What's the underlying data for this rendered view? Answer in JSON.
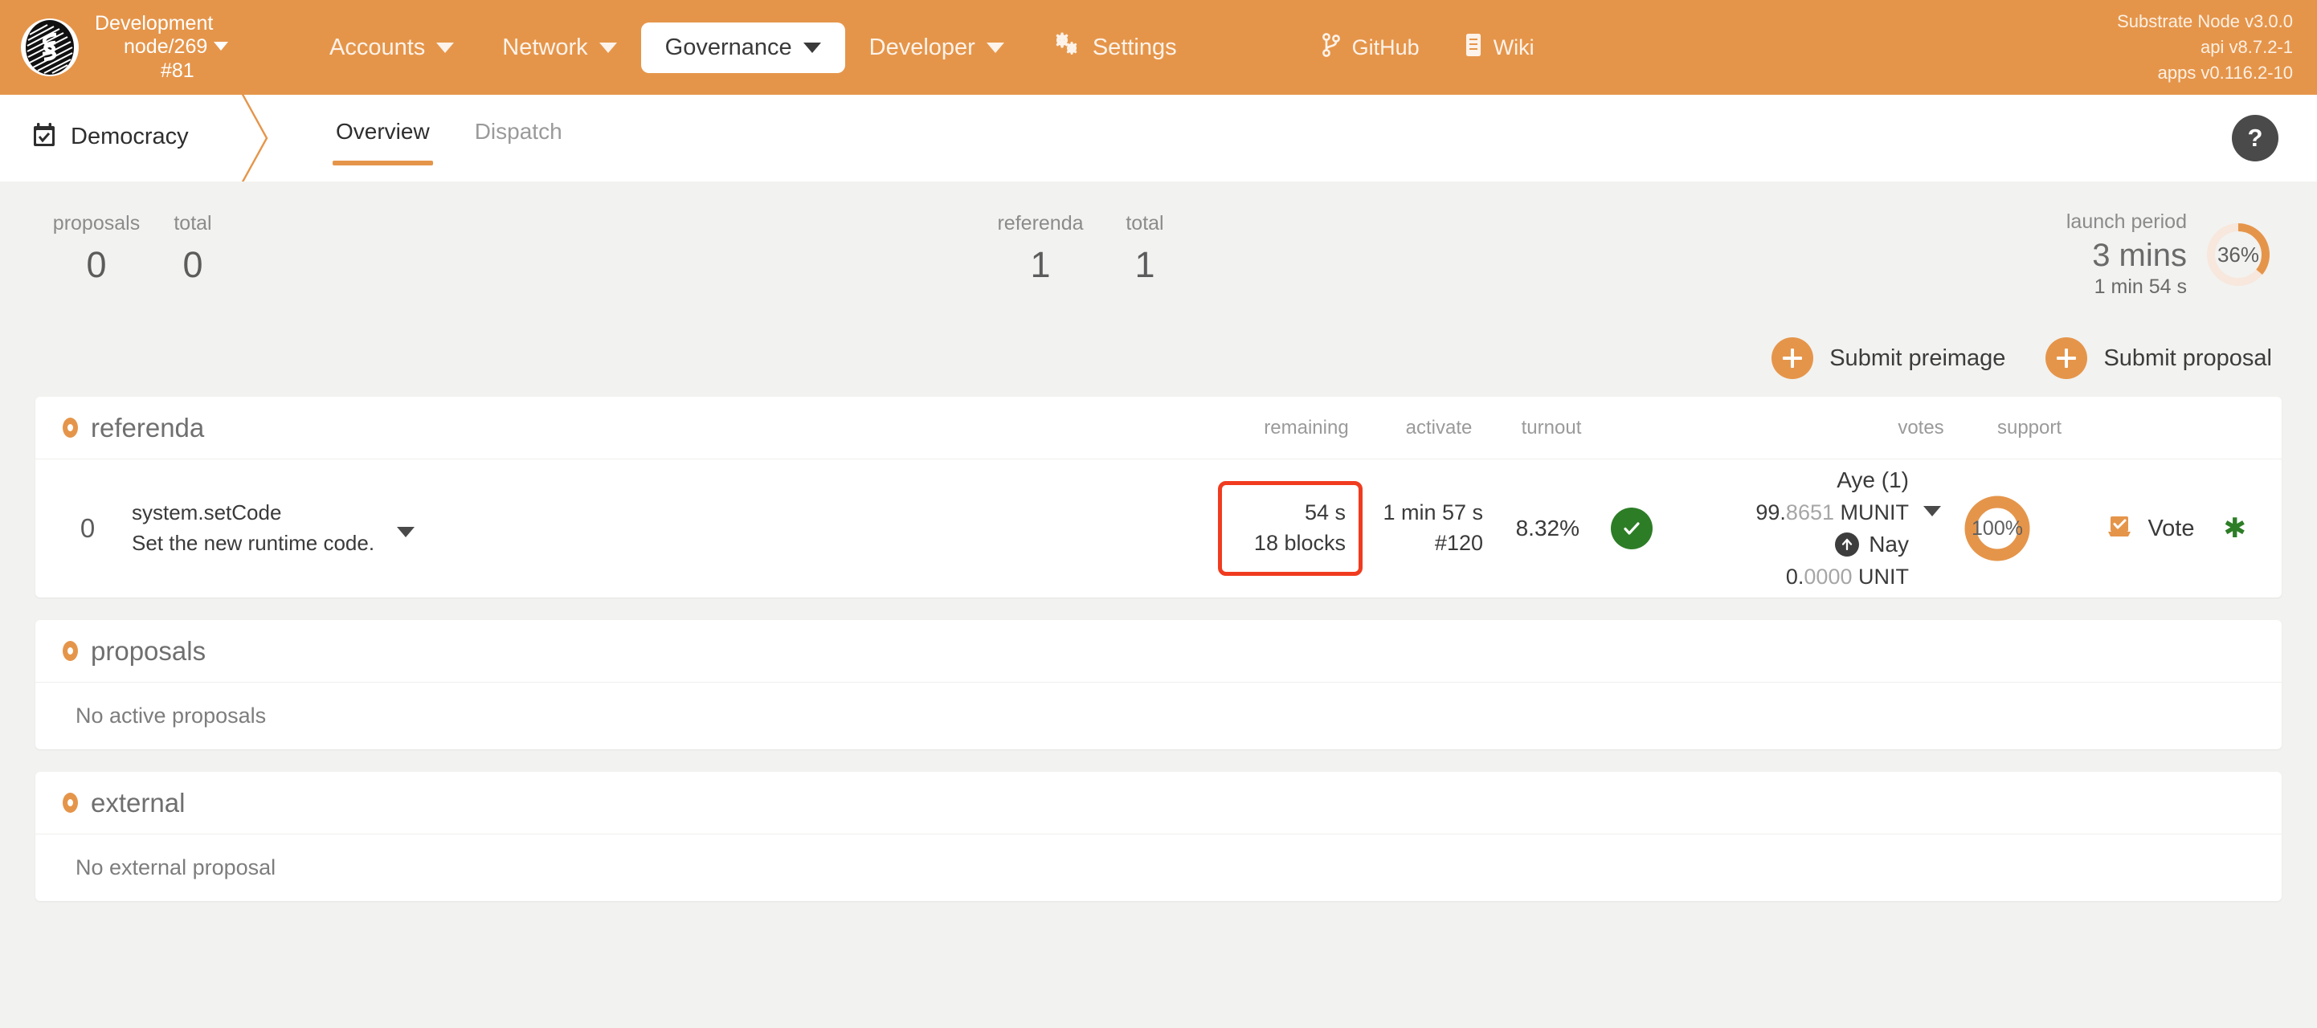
{
  "header": {
    "chain": {
      "name": "Development",
      "node": "node/269",
      "block": "#81",
      "logo_icon": "substrate-logo-icon",
      "caret_icon": "chevron-down-icon"
    },
    "nav": [
      {
        "label": "Accounts",
        "active": false,
        "icon": "chevron-down-icon"
      },
      {
        "label": "Network",
        "active": false,
        "icon": "chevron-down-icon"
      },
      {
        "label": "Governance",
        "active": true,
        "icon": "chevron-down-icon"
      },
      {
        "label": "Developer",
        "active": false,
        "icon": "chevron-down-icon"
      },
      {
        "label": "Settings",
        "active": false,
        "icon": "gears-icon"
      }
    ],
    "links": [
      {
        "label": "GitHub",
        "icon": "git-branch-icon"
      },
      {
        "label": "Wiki",
        "icon": "book-icon"
      }
    ],
    "version": {
      "node": "Substrate Node v3.0.0",
      "api": "api v8.7.2-1",
      "apps": "apps v0.116.2-10"
    },
    "bar_color": "#e5954a"
  },
  "subnav": {
    "section_icon": "calendar-check-icon",
    "section_title": "Democracy",
    "tabs": [
      {
        "label": "Overview",
        "active": true
      },
      {
        "label": "Dispatch",
        "active": false
      }
    ],
    "help_icon": "question-mark-icon",
    "help_label": "?"
  },
  "summary": {
    "left": [
      {
        "label": "proposals",
        "value": "0"
      },
      {
        "label": "total",
        "value": "0"
      }
    ],
    "mid": [
      {
        "label": "referenda",
        "value": "1"
      },
      {
        "label": "total",
        "value": "1"
      }
    ],
    "launch": {
      "label": "launch period",
      "main": "3 mins",
      "sub": "1 min 54 s",
      "percent_label": "36%",
      "percent": 36,
      "accent_color": "#e5954a",
      "track_color": "#f7e7dc"
    }
  },
  "actions": [
    {
      "label": "Submit preimage",
      "icon": "plus-icon"
    },
    {
      "label": "Submit proposal",
      "icon": "plus-icon"
    }
  ],
  "referenda_panel": {
    "title": "referenda",
    "bullet_icon": "ring-bullet-icon",
    "columns": {
      "remaining": "remaining",
      "activate": "activate",
      "turnout": "turnout",
      "votes": "votes",
      "support": "support"
    },
    "row": {
      "index": "0",
      "call": "system.setCode",
      "description": "Set the new runtime code.",
      "toggle_icon": "chevron-down-icon",
      "remaining_time": "54 s",
      "remaining_blocks": "18 blocks",
      "remaining_highlight_color": "#f03b1f",
      "activate_time": "1 min 57 s",
      "activate_block": "#120",
      "turnout": "8.32%",
      "status_icon": "check-circle-icon",
      "status_color": "#2d7d27",
      "aye_label": "Aye (1)",
      "aye_amount_int": "99.",
      "aye_amount_dec": "8651",
      "aye_unit": "MUNIT",
      "votes_toggle_icon": "chevron-down-icon",
      "nay_icon": "arrow-up-circle-icon",
      "nay_label": "Nay",
      "nay_amount_int": "0.",
      "nay_amount_dec": "0000",
      "nay_unit": "UNIT",
      "support_percent_label": "100%",
      "support_percent": 100,
      "vote_icon": "ballot-box-icon",
      "vote_label": "Vote",
      "star_icon": "asterisk-icon",
      "star_glyph": "✱"
    }
  },
  "proposals_panel": {
    "title": "proposals",
    "bullet_icon": "ring-bullet-icon",
    "empty": "No active proposals"
  },
  "external_panel": {
    "title": "external",
    "bullet_icon": "ring-bullet-icon",
    "empty": "No external proposal"
  }
}
